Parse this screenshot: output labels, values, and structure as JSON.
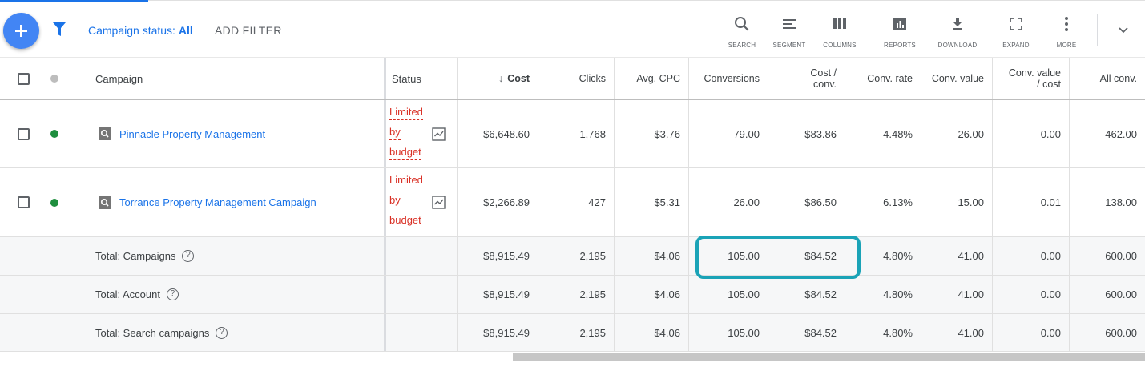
{
  "toolbar": {
    "status_prefix": "Campaign status: ",
    "status_value": "All",
    "add_filter": "ADD FILTER",
    "tools": [
      {
        "label": "SEARCH",
        "icon": "search-icon"
      },
      {
        "label": "SEGMENT",
        "icon": "segment-icon"
      },
      {
        "label": "COLUMNS",
        "icon": "columns-icon"
      },
      {
        "label": "REPORTS",
        "icon": "reports-icon"
      },
      {
        "label": "DOWNLOAD",
        "icon": "download-icon"
      },
      {
        "label": "EXPAND",
        "icon": "expand-icon"
      },
      {
        "label": "MORE",
        "icon": "more-vert-icon"
      }
    ]
  },
  "table": {
    "headers": {
      "campaign": "Campaign",
      "status": "Status",
      "cost": "Cost",
      "clicks": "Clicks",
      "avg_cpc": "Avg. CPC",
      "conversions": "Conversions",
      "cost_conv_line1": "Cost /",
      "cost_conv_line2": "conv.",
      "conv_rate": "Conv. rate",
      "conv_value": "Conv. value",
      "conv_value_cost_line1": "Conv. value",
      "conv_value_cost_line2": "/ cost",
      "all_conv": "All conv."
    },
    "sort_arrow": "↓",
    "rows": [
      {
        "campaign": "Pinnacle Property Management",
        "status_lines": [
          "Limited",
          "by",
          "budget"
        ],
        "cost": "$6,648.60",
        "clicks": "1,768",
        "avg_cpc": "$3.76",
        "conversions": "79.00",
        "cost_conv": "$83.86",
        "conv_rate": "4.48%",
        "conv_value": "26.00",
        "conv_value_cost": "0.00",
        "all_conv": "462.00"
      },
      {
        "campaign": "Torrance Property Management Campaign",
        "status_lines": [
          "Limited",
          "by",
          "budget"
        ],
        "cost": "$2,266.89",
        "clicks": "427",
        "avg_cpc": "$5.31",
        "conversions": "26.00",
        "cost_conv": "$86.50",
        "conv_rate": "6.13%",
        "conv_value": "15.00",
        "conv_value_cost": "0.01",
        "all_conv": "138.00"
      }
    ],
    "totals": [
      {
        "label": "Total: Campaigns",
        "help": "?",
        "cost": "$8,915.49",
        "clicks": "2,195",
        "avg_cpc": "$4.06",
        "conversions": "105.00",
        "cost_conv": "$84.52",
        "conv_rate": "4.80%",
        "conv_value": "41.00",
        "conv_value_cost": "0.00",
        "all_conv": "600.00"
      },
      {
        "label": "Total: Account",
        "help": "?",
        "cost": "$8,915.49",
        "clicks": "2,195",
        "avg_cpc": "$4.06",
        "conversions": "105.00",
        "cost_conv": "$84.52",
        "conv_rate": "4.80%",
        "conv_value": "41.00",
        "conv_value_cost": "0.00",
        "all_conv": "600.00"
      },
      {
        "label": "Total: Search campaigns",
        "help": "?",
        "cost": "$8,915.49",
        "clicks": "2,195",
        "avg_cpc": "$4.06",
        "conversions": "105.00",
        "cost_conv": "$84.52",
        "conv_rate": "4.80%",
        "conv_value": "41.00",
        "conv_value_cost": "0.00",
        "all_conv": "600.00"
      }
    ]
  },
  "colors": {
    "brand_blue": "#1a73e8",
    "fab_blue": "#4285f4",
    "limited_red": "#d93025",
    "enabled_green": "#1e8e3e",
    "highlight_teal": "#1aa3b7"
  }
}
